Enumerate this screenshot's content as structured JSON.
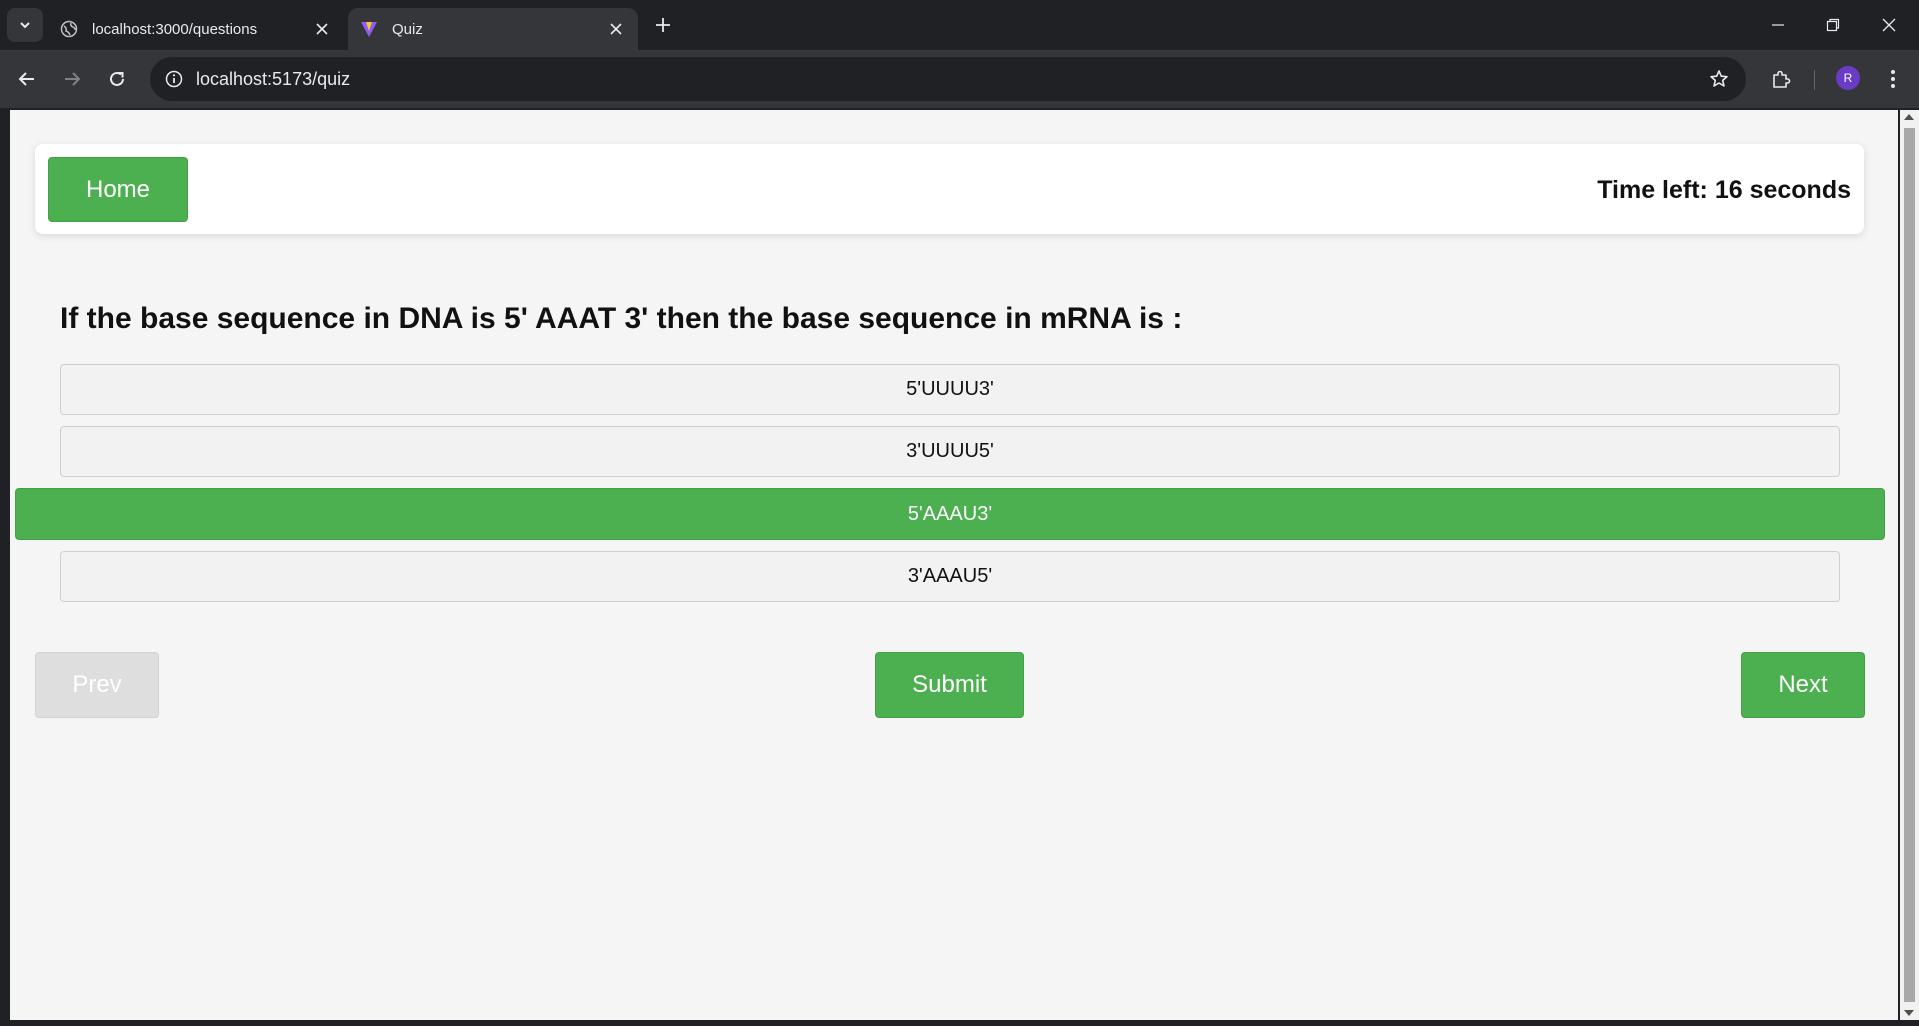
{
  "browser": {
    "tabs": [
      {
        "title": "localhost:3000/questions",
        "active": false
      },
      {
        "title": "Quiz",
        "active": true
      }
    ],
    "url": "localhost:5173/quiz",
    "profile_initial": "R"
  },
  "quiz": {
    "home_label": "Home",
    "timer_text": "Time left: 16 seconds",
    "question": "If the base sequence in DNA is 5' AAAT 3' then the base sequence in mRNA is :",
    "options": [
      "5'UUUU3'",
      "3'UUUU5'",
      "5'AAAU3'",
      "3'AAAU5'"
    ],
    "selected_option_index": 2,
    "prev_label": "Prev",
    "submit_label": "Submit",
    "next_label": "Next"
  },
  "colors": {
    "accent": "#4caf50",
    "disabled": "#dedede",
    "page_bg": "#f5f5f5",
    "chrome_bg": "#202124"
  }
}
